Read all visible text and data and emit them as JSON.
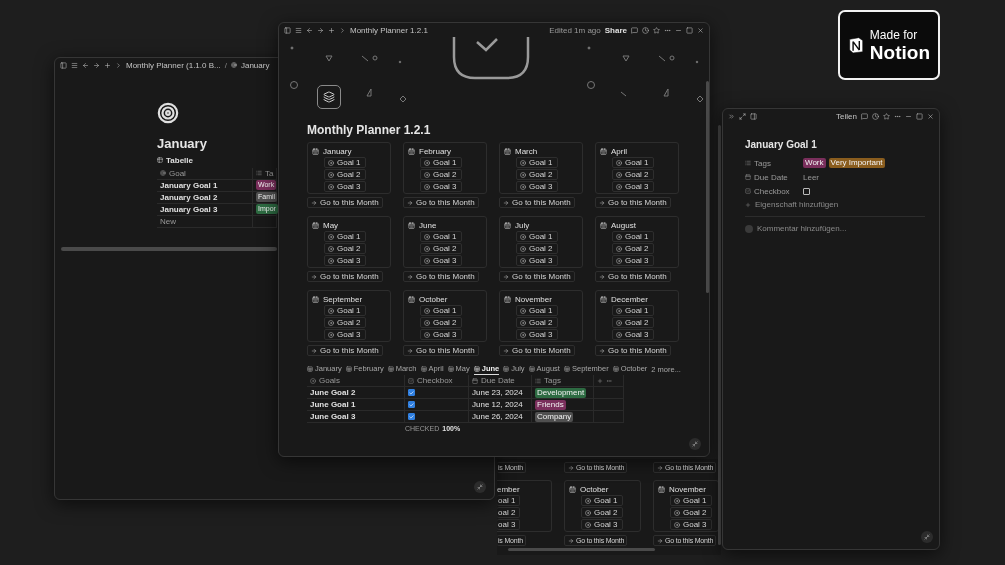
{
  "badge": {
    "caption": "Made for",
    "brand": "Notion"
  },
  "back_window": {
    "top_buttons": [
      "is Month",
      "Go to this Month",
      "Go to this Month"
    ],
    "cards": [
      {
        "kind": "cut",
        "month": "ember",
        "goals": [
          "oal 1",
          "oal 2",
          "oal 3"
        ]
      },
      {
        "kind": "full",
        "month": "October",
        "goals": [
          "Goal 1",
          "Goal 2",
          "Goal 3"
        ]
      },
      {
        "kind": "full",
        "month": "November",
        "goals": [
          "Goal 1",
          "Goal 2",
          "Goal 3"
        ]
      }
    ],
    "bottom_buttons": [
      "is Month",
      "Go to this Month",
      "Go to this Month"
    ]
  },
  "left_window": {
    "breadcrumb": [
      "Monthly Planner (1.1.0 B...",
      "January"
    ],
    "separator": "/",
    "title": "January",
    "view": "Tabelle",
    "columns": [
      "Goal",
      "Ta"
    ],
    "rows": [
      {
        "goal": "January Goal 1",
        "tag": "Work",
        "color": "#7a2f5c"
      },
      {
        "goal": "January Goal 2",
        "tag": "Famil",
        "color": "#505050"
      },
      {
        "goal": "January Goal 3",
        "tag": "Impor",
        "color": "#2d6b42"
      }
    ],
    "new_row": "New"
  },
  "main_window": {
    "breadcrumb": "Monthly Planner 1.2.1",
    "edited": "Edited 1m ago",
    "share": "Share",
    "title": "Monthly Planner 1.2.1",
    "months": [
      {
        "name": "January",
        "goals": [
          "Goal 1",
          "Goal 2",
          "Goal 3"
        ],
        "button": "Go to this Month"
      },
      {
        "name": "February",
        "goals": [
          "Goal 1",
          "Goal 2",
          "Goal 3"
        ],
        "button": "Go to this Month"
      },
      {
        "name": "March",
        "goals": [
          "Goal 1",
          "Goal 2",
          "Goal 3"
        ],
        "button": "Go to this Month"
      },
      {
        "name": "April",
        "goals": [
          "Goal 1",
          "Goal 2",
          "Goal 3"
        ],
        "button": "Go to this Month"
      },
      {
        "name": "May",
        "goals": [
          "Goal 1",
          "Goal 2",
          "Goal 3"
        ],
        "button": "Go to this Month"
      },
      {
        "name": "June",
        "goals": [
          "Goal 1",
          "Goal 2",
          "Goal 3"
        ],
        "button": "Go to this Month"
      },
      {
        "name": "July",
        "goals": [
          "Goal 1",
          "Goal 2",
          "Goal 3"
        ],
        "button": "Go to this Month"
      },
      {
        "name": "August",
        "goals": [
          "Goal 1",
          "Goal 2",
          "Goal 3"
        ],
        "button": "Go to this Month"
      },
      {
        "name": "September",
        "goals": [
          "Goal 1",
          "Goal 2",
          "Goal 3"
        ],
        "button": "Go to this Month"
      },
      {
        "name": "October",
        "goals": [
          "Goal 1",
          "Goal 2",
          "Goal 3"
        ],
        "button": "Go to this Month"
      },
      {
        "name": "November",
        "goals": [
          "Goal 1",
          "Goal 2",
          "Goal 3"
        ],
        "button": "Go to this Month"
      },
      {
        "name": "December",
        "goals": [
          "Goal 1",
          "Goal 2",
          "Goal 3"
        ],
        "button": "Go to this Month"
      }
    ],
    "tabs": [
      {
        "label": "January",
        "selected": false
      },
      {
        "label": "February",
        "selected": false
      },
      {
        "label": "March",
        "selected": false
      },
      {
        "label": "April",
        "selected": false
      },
      {
        "label": "May",
        "selected": false
      },
      {
        "label": "June",
        "selected": true
      },
      {
        "label": "July",
        "selected": false
      },
      {
        "label": "August",
        "selected": false
      },
      {
        "label": "September",
        "selected": false
      },
      {
        "label": "October",
        "selected": false
      }
    ],
    "more_tabs": "2 more...",
    "columns": [
      "Goals",
      "Checkbox",
      "Due Date",
      "Tags"
    ],
    "rows": [
      {
        "goal": "June Goal 2",
        "checked": true,
        "due": "June 23, 2024",
        "tag": "Development",
        "color": "#2d6b42"
      },
      {
        "goal": "June Goal 1",
        "checked": true,
        "due": "June 12, 2024",
        "tag": "Friends",
        "color": "#7a2f5c"
      },
      {
        "goal": "June Goal 3",
        "checked": true,
        "due": "June 26, 2024",
        "tag": "Company",
        "color": "#505050"
      }
    ],
    "footer": {
      "label": "CHECKED",
      "value": "100%"
    }
  },
  "right_window": {
    "share": "Teilen",
    "title": "January Goal 1",
    "properties": [
      {
        "kind": "tags",
        "label": "Tags",
        "tags": [
          {
            "text": "Work",
            "color": "#7a2f5c"
          },
          {
            "text": "Very Important",
            "color": "#8a5d1e"
          }
        ]
      },
      {
        "kind": "date",
        "label": "Due Date",
        "value": "Leer"
      },
      {
        "kind": "checkbox",
        "label": "Checkbox",
        "checked": false
      }
    ],
    "add_property": "Eigenschaft hinzufügen",
    "comment_placeholder": "Kommentar hinzufügen..."
  }
}
